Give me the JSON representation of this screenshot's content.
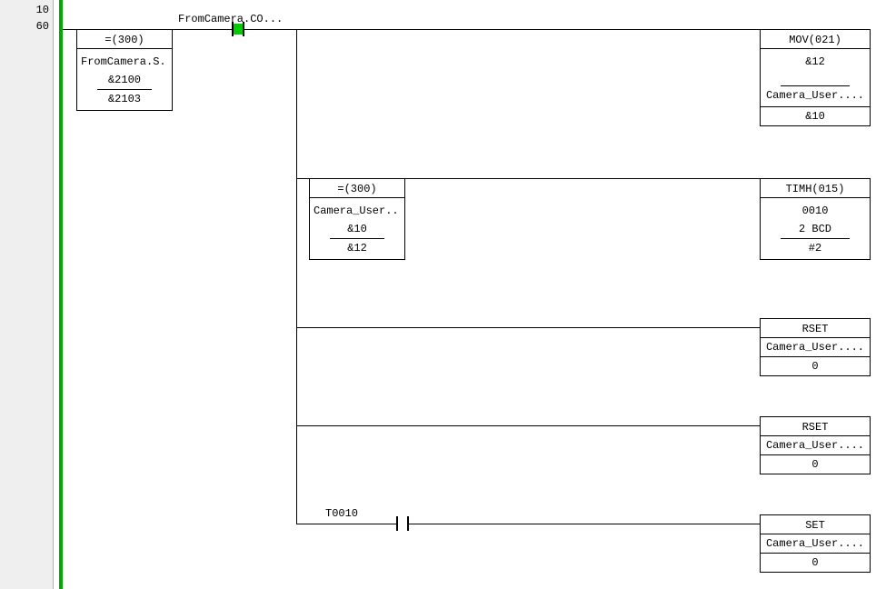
{
  "gutter": {
    "topNum": "10",
    "rungNum": "60"
  },
  "topContact": {
    "label": "FromCamera.CO..."
  },
  "midContact": {
    "label": "T0010"
  },
  "blocks": {
    "cmp1": {
      "title": "=(300)",
      "l1": "FromCamera.S...",
      "l2": "&2100",
      "l3": "&2103"
    },
    "mov": {
      "title": "MOV(021)",
      "l1": "&12",
      "l2": "Camera_User....",
      "l3": "&10"
    },
    "cmp2": {
      "title": "=(300)",
      "l1": "Camera_User....",
      "l2": "&10",
      "l3": "&12"
    },
    "timh": {
      "title": "TIMH(015)",
      "l1": "0010",
      "l2": "2 BCD",
      "l3": "#2"
    },
    "rset1": {
      "title": "RSET",
      "l1": "Camera_User....",
      "l2": "0"
    },
    "rset2": {
      "title": "RSET",
      "l1": "Camera_User....",
      "l2": "0"
    },
    "set": {
      "title": "SET",
      "l1": "Camera_User....",
      "l2": "0"
    }
  }
}
